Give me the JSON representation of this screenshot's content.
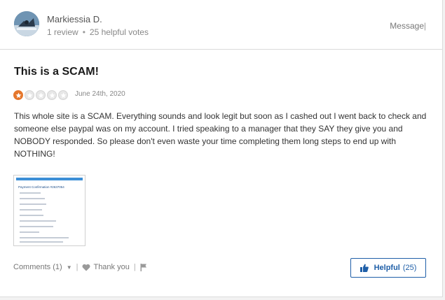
{
  "reviewer": {
    "name": "Markiessia D.",
    "review_count": "1 review",
    "helpful_votes": "25 helpful votes",
    "avatar": "avatar-photo-icon"
  },
  "header": {
    "message_label": "Message",
    "separator": "|"
  },
  "review": {
    "title": "This is a SCAM!",
    "rating": 1,
    "rating_max": 5,
    "date": "June 24th, 2020",
    "body": "This whole site is a SCAM. Everything sounds and look legit but soon as I cashed out I went back to check and someone else paypal was on my account. I tried speaking to a manager that they SAY they give you and NOBODY responded. So please don't even waste your time completing them long steps to end up with NOTHING!",
    "attachment_title": "Payment Confirmation #2637054"
  },
  "footer": {
    "comments_label": "Comments (1)",
    "thank_you_label": "Thank you",
    "separator": "|",
    "helpful_label": "Helpful",
    "helpful_count": "(25)"
  },
  "colors": {
    "star_filled": "#e5772d",
    "star_empty": "#e7e7e7",
    "accent": "#1f5fa8"
  }
}
